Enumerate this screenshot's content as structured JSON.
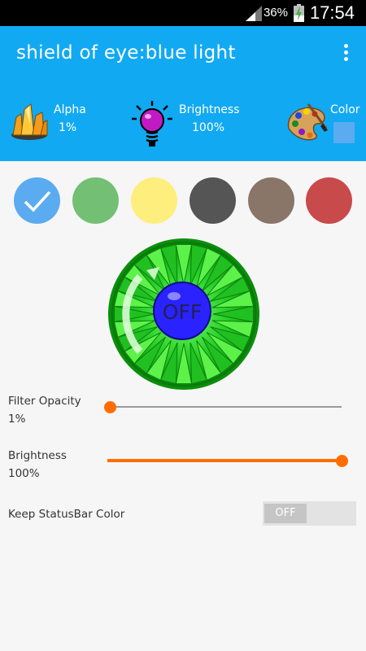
{
  "status_bar": {
    "battery_percent": "36%",
    "time": "17:54"
  },
  "app_bar": {
    "title": "shield of eye:blue light",
    "menu_icon": "overflow-menu-icon"
  },
  "info": {
    "alpha": {
      "label": "Alpha",
      "value": "1%",
      "icon": "crystals-icon"
    },
    "brightness": {
      "label": "Brightness",
      "value": "100%",
      "icon": "lightbulb-icon"
    },
    "color": {
      "label": "Color",
      "icon": "palette-icon",
      "swatch_color": "#5aabf0"
    }
  },
  "swatches": [
    {
      "color": "#5aabf0",
      "selected": true
    },
    {
      "color": "#73bf73"
    },
    {
      "color": "#fdee7e"
    },
    {
      "color": "#555555"
    },
    {
      "color": "#8a7569"
    },
    {
      "color": "#c84a4a"
    }
  ],
  "power_button": {
    "label": "OFF"
  },
  "filter_opacity": {
    "label": "Filter Opacity",
    "value": "1%",
    "level": 0.01
  },
  "brightness_setting": {
    "label": "Brightness",
    "value": "100%",
    "level": 1.0
  },
  "keep_statusbar": {
    "label": "Keep StatusBar Color",
    "state": "OFF"
  },
  "colors": {
    "accent": "#12a9f3",
    "slider": "#ff6d00"
  }
}
